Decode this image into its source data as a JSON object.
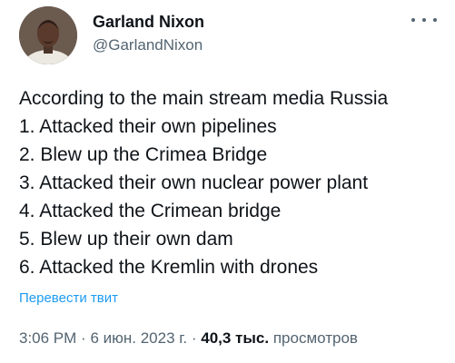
{
  "author": {
    "display_name": "Garland Nixon",
    "handle": "@GarlandNixon"
  },
  "tweet": {
    "lines": [
      "According to the main stream media Russia",
      "1. Attacked their own pipelines",
      "2. Blew up the Crimea Bridge",
      "3. Attacked their own nuclear power plant",
      "4. Attacked the Crimean bridge",
      "5. Blew up their own dam",
      "6. Attacked the Kremlin with drones"
    ],
    "translate_label": "Перевести твит"
  },
  "meta": {
    "time": "3:06 PM",
    "separator": "·",
    "date": "6 июн. 2023 г.",
    "views_count": "40,3 тыс.",
    "views_label": "просмотров"
  },
  "icons": {
    "more": "more-horizontal-icon",
    "avatar": "profile-photo"
  },
  "colors": {
    "text_primary": "#0f1419",
    "text_secondary": "#536471",
    "link": "#1d9bf0",
    "background": "#ffffff"
  }
}
